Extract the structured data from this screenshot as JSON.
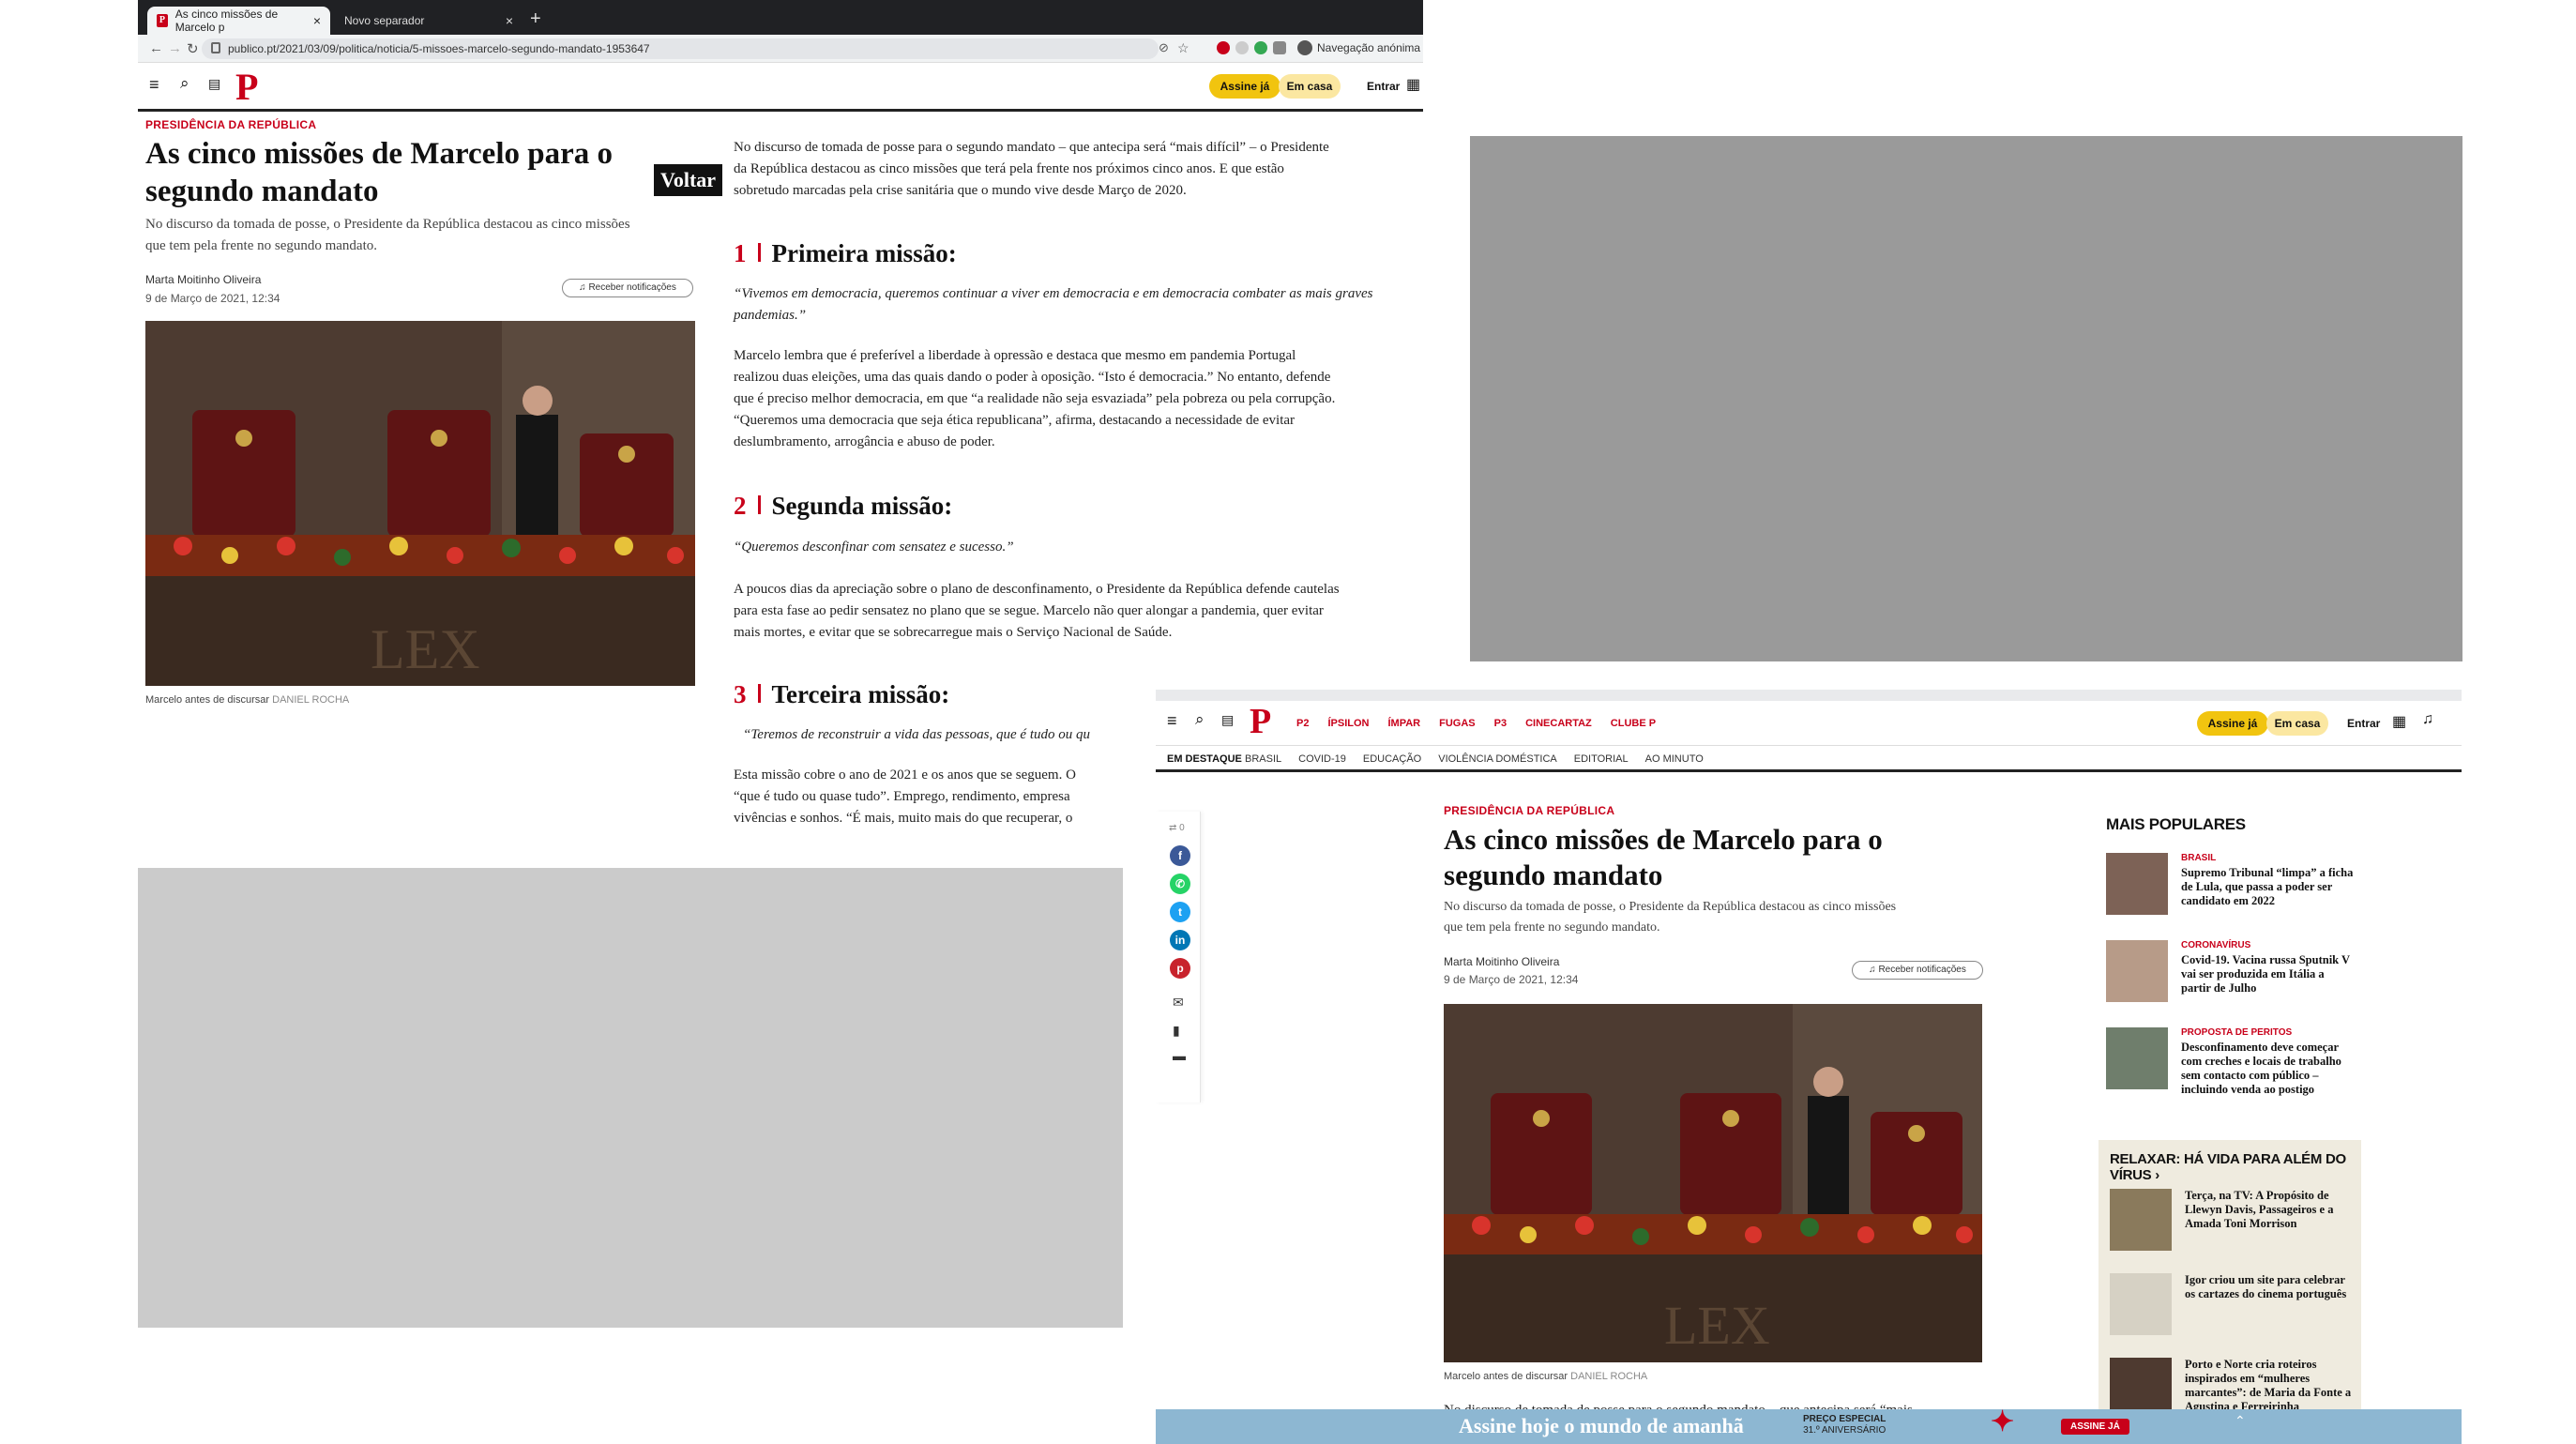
{
  "browser": {
    "active_tab": "As cinco missões de Marcelo p",
    "second_tab": "Novo separador",
    "url": "publico.pt/2021/03/09/politica/noticia/5-missoes-marcelo-segundo-mandato-1953647",
    "incognito_label": "Navegação anónima"
  },
  "header": {
    "logo": "P",
    "subscribe": "Assine já",
    "home": "Em casa",
    "login": "Entrar",
    "nav": [
      "P2",
      "ÍPSILON",
      "ÍMPAR",
      "FUGAS",
      "P3",
      "CINECARTAZ",
      "CLUBE P"
    ],
    "highlight": "EM DESTAQUE",
    "topics": [
      "BRASIL",
      "COVID-19",
      "EDUCAÇÃO",
      "VIOLÊNCIA DOMÉSTICA",
      "EDITORIAL",
      "AO MINUTO"
    ]
  },
  "article": {
    "kicker": "PRESIDÊNCIA DA REPÚBLICA",
    "title_line1": "As cinco missões de Marcelo para o",
    "title_line2": "segundo mandato",
    "lead_line1": "No discurso da tomada de posse, o Presidente da República destacou as cinco missões",
    "lead_line2": "que tem pela frente no segundo mandato.",
    "author": "Marta Moitinho Oliveira",
    "date": "9 de Março de 2021, 12:34",
    "notifications": "Receber notificações",
    "caption": "Marcelo antes de discursar",
    "photo_credit": "DANIEL ROCHA",
    "back_label": "Voltar",
    "intro": [
      "No discurso de tomada de posse para o segundo mandato – que antecipa será “mais difícil”  – o Presidente",
      "da República destacou as cinco missões que terá pela frente nos próximos cinco anos. E que estão",
      "sobretudo marcadas pela crise sanitária que o mundo vive desde Março de 2020."
    ],
    "m1_num": "1",
    "m1_title": "Primeira missão:",
    "m1_quote": [
      "“Vivemos em democracia, queremos continuar a viver em democracia e em democracia combater as mais graves",
      "pandemias.”"
    ],
    "m1_body": [
      "Marcelo lembra que é preferível a liberdade à opressão e destaca que mesmo em pandemia Portugal",
      "realizou duas eleições, uma das quais dando o poder à oposição. “Isto é democracia.” No entanto, defende",
      "que é preciso melhor democracia, em que  “a realidade não seja esvaziada” pela pobreza ou pela corrupção.",
      "“Queremos uma democracia que seja ética republicana”, afirma, destacando a necessidade de evitar",
      "deslumbramento, arrogância e abuso de poder."
    ],
    "m2_num": "2",
    "m2_title": "Segunda missão:",
    "m2_quote": "“Queremos desconfinar com sensatez e sucesso.”",
    "m2_body": [
      "A poucos dias da apreciação sobre o plano de desconfinamento, o Presidente da República defende cautelas",
      "para esta fase ao pedir sensatez no plano que se segue. Marcelo não quer alongar a pandemia, quer evitar",
      "mais mortes, e evitar que se sobrecarregue mais o Serviço Nacional de Saúde."
    ],
    "m3_num": "3",
    "m3_title": "Terceira missão:",
    "m3_quote": "“Teremos de reconstruir a vida das pessoas, que é tudo ou qu",
    "m3_body": [
      "Esta missão cobre o ano de 2021 e os anos que se seguem. O",
      "“que é tudo ou quase tudo”. Emprego, rendimento, empresa",
      "vivências e sonhos. “É mais, muito mais do que recuperar, o"
    ],
    "intro_cut": "No discurso de tomada de posse para o segundo mandato – que antecipa será “mais"
  },
  "share": {
    "count": "0"
  },
  "sidebar": {
    "popular_title": "MAIS POPULARES",
    "popular": [
      {
        "cat": "BRASIL",
        "text": "Supremo Tribunal “limpa” a ficha de Lula, que passa a poder ser candidato em 2022"
      },
      {
        "cat": "CORONAVÍRUS",
        "text": "Covid-19. Vacina russa Sputnik V vai ser produzida em Itália a partir de Julho"
      },
      {
        "cat": "PROPOSTA DE PERITOS",
        "text": "Desconfinamento deve começar com creches e locais de trabalho sem contacto com público – incluindo venda ao postigo"
      }
    ],
    "relax_title": "RELAXAR: HÁ VIDA PARA ALÉM DO VÍRUS",
    "relax": [
      {
        "text": "Terça, na TV: A Propósito de Llewyn Davis, Passageiros e a Amada Toni Morrison"
      },
      {
        "text": "Igor criou um site para celebrar os cartazes do cinema português"
      },
      {
        "text": "Porto e Norte cria roteiros inspirados em “mulheres marcantes”: de Maria da Fonte a Agustina e Ferreirinha"
      }
    ]
  },
  "banner": {
    "text": "Assine hoje o mundo de amanhã",
    "special": "PREÇO ESPECIAL",
    "anniversary": "31.º ANIVERSÁRIO",
    "cta": "ASSINE JÁ"
  },
  "colors": {
    "brand": "#c8001a",
    "subscribe": "#f1c40f"
  }
}
